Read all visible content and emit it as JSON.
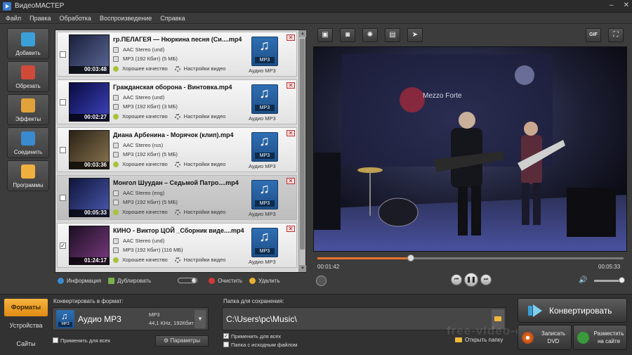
{
  "window": {
    "title": "ВидеоМАСТЕР",
    "controls": [
      "–",
      "✕"
    ]
  },
  "menu": [
    "Файл",
    "Правка",
    "Обработка",
    "Воспроизведение",
    "Справка"
  ],
  "nav": [
    {
      "label": "Добавить",
      "icon": "add-film-icon",
      "color": "#3aa0d8"
    },
    {
      "label": "Обрезать",
      "icon": "trim-film-icon",
      "color": "#d04a3a"
    },
    {
      "label": "Эффекты",
      "icon": "effects-icon",
      "color": "#e2a23a"
    },
    {
      "label": "Соединить",
      "icon": "join-film-icon",
      "color": "#3a8ad0"
    },
    {
      "label": "Программы",
      "icon": "programs-icon",
      "color": "#f0b040"
    }
  ],
  "files": [
    {
      "title": "гр.ПЕЛАГЕЯ — Нюркина песня (Си....mp4",
      "audio": "AAC Stereo (und)",
      "size": "MP3 (192 Кбит) (5 МБ)",
      "quality": "Хорошее качество",
      "settings": "Настройки видео",
      "format_badge": "MP3",
      "format_label": "Аудио MP3",
      "duration": "00:03:48",
      "checked": "",
      "selected": false,
      "thumb_colors": [
        "#1a1f3a",
        "#5d6b9a"
      ]
    },
    {
      "title": "Гражданская оборона - Винтовка.mp4",
      "audio": "AAC Stereo (und)",
      "size": "MP3 (192 Кбит) (3 МБ)",
      "quality": "Хорошее качество",
      "settings": "Настройки видео",
      "format_badge": "MP3",
      "format_label": "Аудио MP3",
      "duration": "00:02:27",
      "checked": "",
      "selected": false,
      "thumb_colors": [
        "#0a0a40",
        "#3d45c0"
      ]
    },
    {
      "title": "Диана Арбенина - Морячок (клип).mp4",
      "audio": "AAC Stereo (rus)",
      "size": "MP3 (192 Кбит) (5 МБ)",
      "quality": "Хорошее качество",
      "settings": "Настройки видео",
      "format_badge": "MP3",
      "format_label": "Аудио MP3",
      "duration": "00:03:36",
      "checked": "",
      "selected": false,
      "thumb_colors": [
        "#2a2215",
        "#8a7550"
      ]
    },
    {
      "title": "Монгол Шуудан – Седьмой Патро....mp4",
      "audio": "AAC Stereo (eng)",
      "size": "MP3 (192 Кбит) (5 МБ)",
      "quality": "Хорошее качество",
      "settings": "Настройки видео",
      "format_badge": "MP3",
      "format_label": "Аудио MP3",
      "duration": "00:05:33",
      "checked": "",
      "selected": true,
      "thumb_colors": [
        "#10143a",
        "#4a5ab0"
      ]
    },
    {
      "title": "КИНО - Виктор ЦОЙ _Сборник виде....mp4",
      "audio": "AAC Stereo (und)",
      "size": "MP3 (192 Кбит) (116 МБ)",
      "quality": "Хорошее качество",
      "settings": "Настройки видео",
      "format_badge": "MP3",
      "format_label": "Аудио MP3",
      "duration": "01:24:17",
      "checked": "✓",
      "selected": false,
      "thumb_colors": [
        "#1c0f22",
        "#7a3a80"
      ]
    }
  ],
  "list_toolbar": {
    "info": "Информация",
    "duplicate": "Дублировать",
    "clear": "Очистить",
    "delete": "Удалить"
  },
  "preview": {
    "tools": [
      "crop-icon",
      "rotate-icon",
      "brightness-icon",
      "film-edit-icon",
      "speed-icon"
    ],
    "gif": "GIF",
    "video_sign": "Mezzo Forte",
    "current_time": "00:01:42",
    "total_time": "00:05:33",
    "progress": 0.306,
    "volume": 0.95,
    "controls": [
      "⏮",
      "❚❚",
      "⏭"
    ]
  },
  "bottom": {
    "tabs": [
      "Форматы",
      "Устройства",
      "Сайты"
    ],
    "active_tab": 0,
    "convert_label": "Конвертировать в формат:",
    "format_badge": "MP3",
    "format_name": "Аудио MP3",
    "format_spec1": "MP3",
    "format_spec2": "44,1 KHz, 192Кбит",
    "apply_all": "Применить для всех",
    "params": "Параметры",
    "folder_label": "Папка для сохранения:",
    "folder_path": "C:\\Users\\pc\\Music\\",
    "apply_all_2": "Применить для всех",
    "same_folder": "Папка с исходным файлом",
    "open_folder": "Открыть папку",
    "convert_btn": "Конвертировать",
    "burn_dvd": "Записать DVD",
    "publish": "Разместить на сайте",
    "watermark": "free-video-editor"
  }
}
